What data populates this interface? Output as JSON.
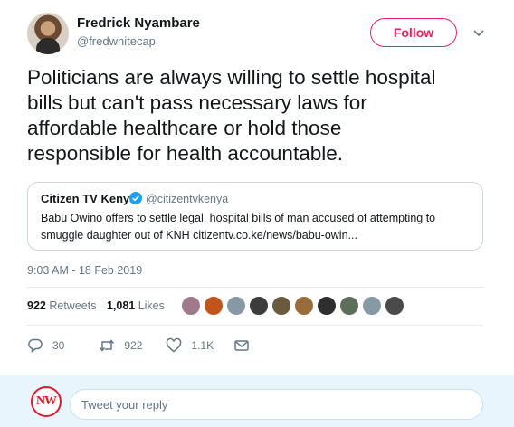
{
  "author": {
    "name": "Fredrick Nyambare",
    "handle": "@fredwhitecap",
    "follow_label": "Follow"
  },
  "tweet": {
    "text_lines": [
      "Politicians are always willing to settle hospital",
      "bills but can't pass necessary laws for",
      "affordable healthcare or hold those",
      "responsible for health accountable."
    ],
    "timestamp": "9:03 AM - 18 Feb 2019"
  },
  "quoted": {
    "name": "Citizen TV Kenya",
    "handle": "@citizentvkenya",
    "text_lines": [
      "Babu Owino offers to settle legal, hospital bills of man accused of attempting to",
      "smuggle daughter out of KNH citizentv.co.ke/news/babu-owin..."
    ]
  },
  "stats": {
    "retweets_count": "922",
    "retweets_label": "Retweets",
    "likes_count": "1,081",
    "likes_label": "Likes"
  },
  "likers": [
    "#a07a8c",
    "#c1541d",
    "#8899a6",
    "#3c3c3c",
    "#6b5b3e",
    "#9a6c3a",
    "#2f2f2f",
    "#5d6f5a",
    "#8899a6",
    "#4a4a4a"
  ],
  "actions": {
    "reply_count": "30",
    "retweet_count": "922",
    "like_count": "1.1K"
  },
  "reply": {
    "avatar_text": "NW",
    "placeholder": "Tweet your reply"
  },
  "colors": {
    "accent": "#e0245e",
    "link": "#1da1f2",
    "muted": "#657786"
  }
}
